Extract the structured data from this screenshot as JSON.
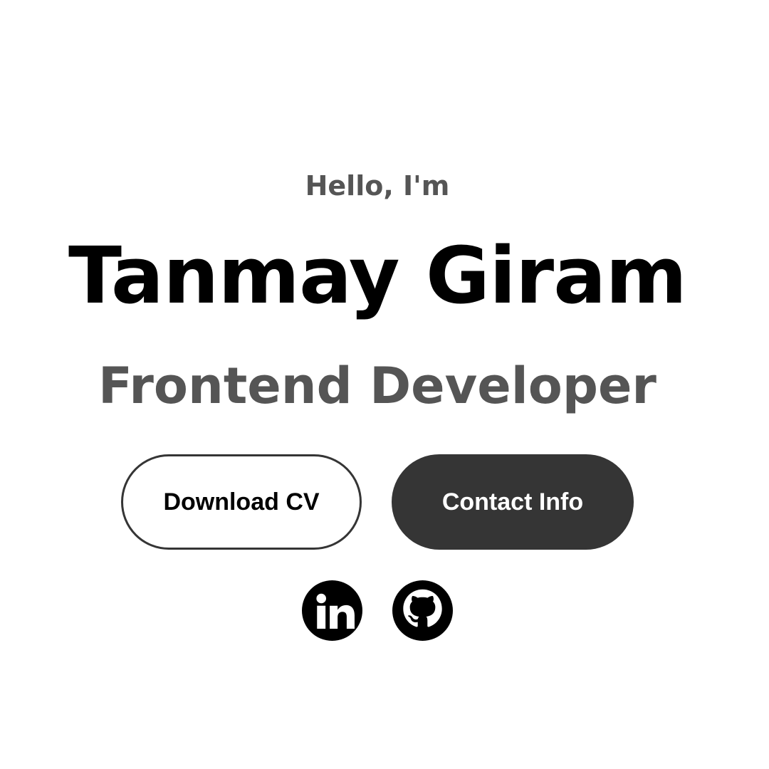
{
  "hero": {
    "greeting": "Hello, I'm",
    "name": "Tanmay Giram",
    "role": "Frontend Developer"
  },
  "buttons": {
    "download_cv": "Download CV",
    "contact_info": "Contact Info"
  },
  "social": {
    "linkedin_icon": "linkedin-icon",
    "github_icon": "github-icon"
  },
  "colors": {
    "background": "#ffffff",
    "primary_text": "#000000",
    "secondary_text": "#555555",
    "dark_button": "#353535"
  }
}
